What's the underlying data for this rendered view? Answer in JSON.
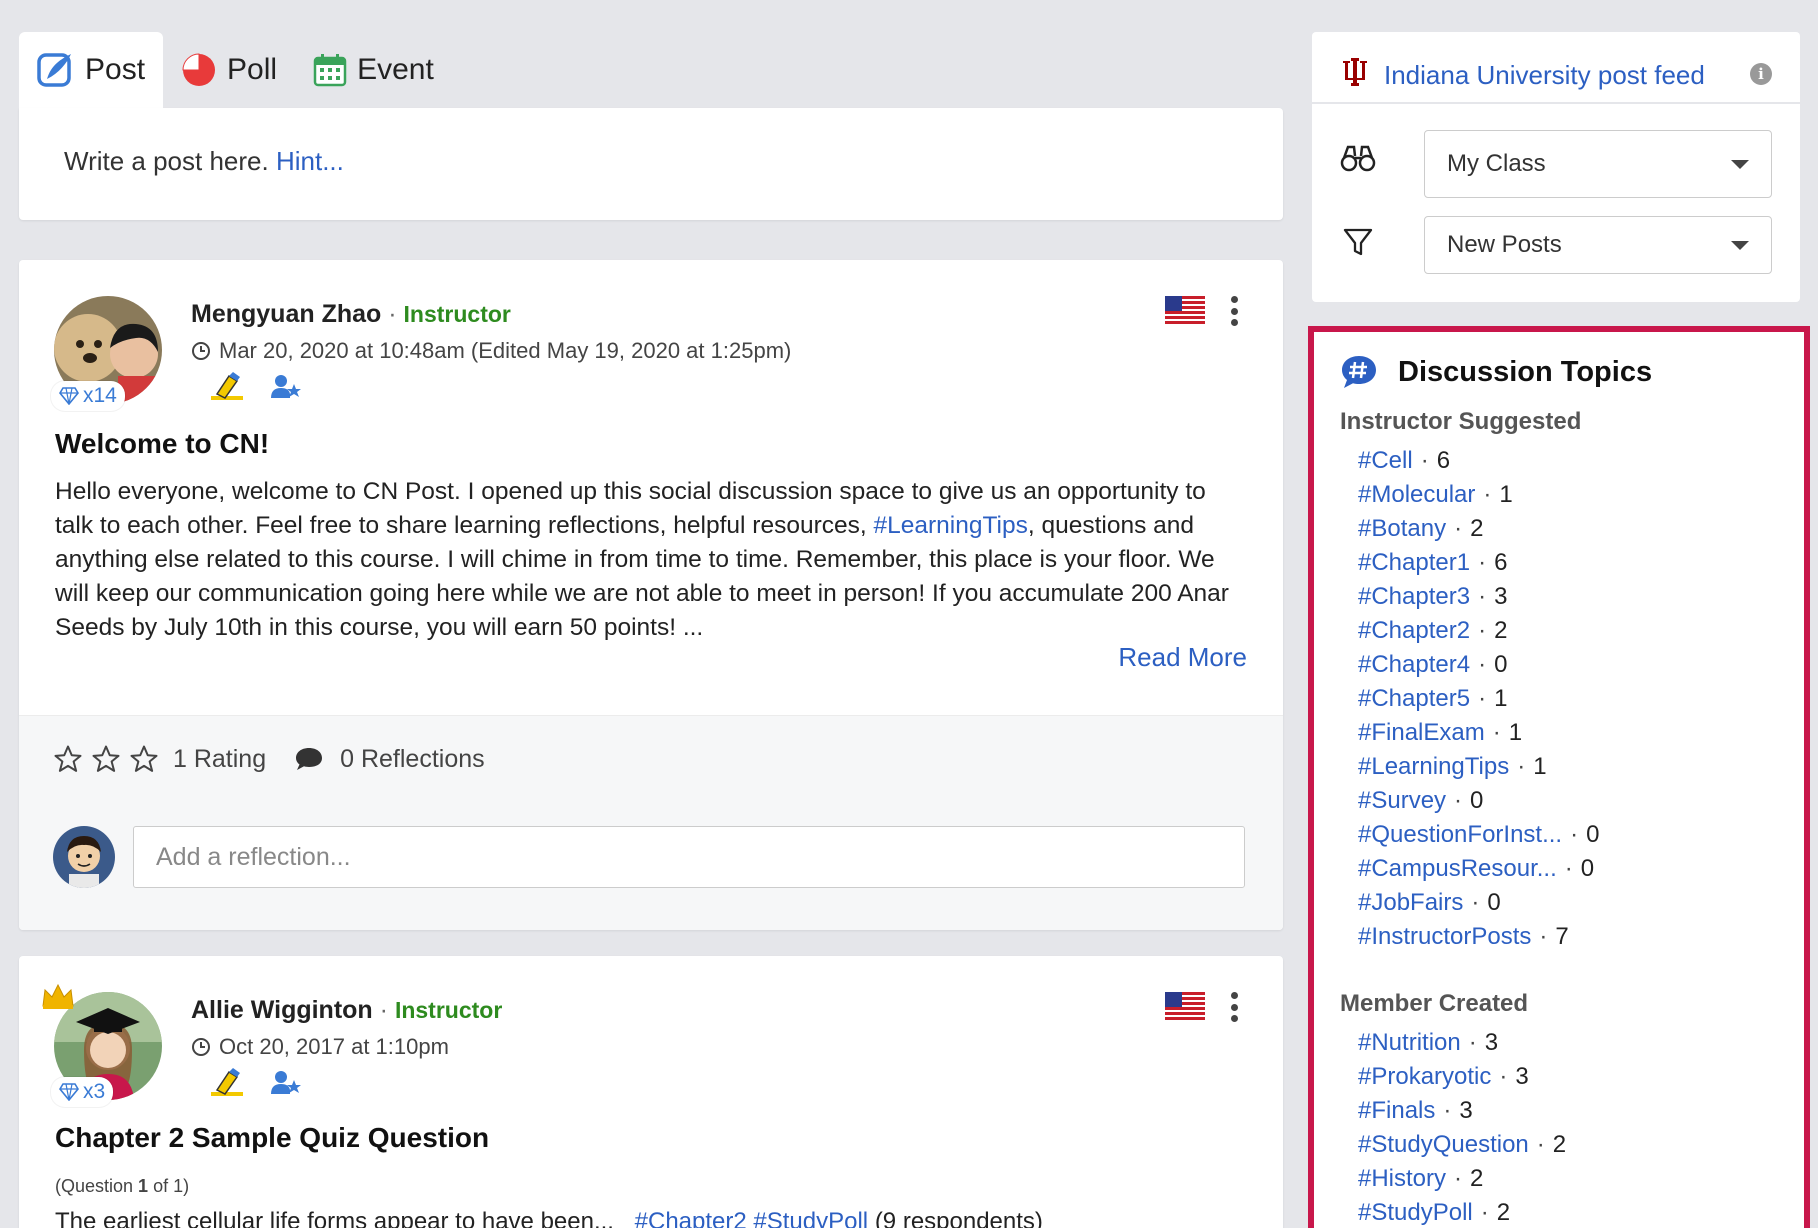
{
  "tabs": [
    {
      "label": "Post",
      "icon": "post-pen-icon",
      "active": true
    },
    {
      "label": "Poll",
      "icon": "pie-chart-icon",
      "active": false
    },
    {
      "label": "Event",
      "icon": "calendar-icon",
      "active": false
    }
  ],
  "composer": {
    "placeholder": "Write a post here.",
    "hint": "Hint..."
  },
  "post1": {
    "author": "Mengyuan Zhao",
    "role": "Instructor",
    "timestamp": "Mar 20, 2020 at 10:48am (Edited May 19, 2020 at 1:25pm)",
    "badge_count": "x14",
    "title": "Welcome to CN!",
    "body_before": "Hello everyone, welcome to CN Post. I opened up this social discussion space to give us an opportunity to talk to each other. Feel free to share learning reflections, helpful resources, ",
    "body_tag": "#LearningTips",
    "body_after": ", questions and anything else related to this course. I will chime in from time to time. Remember, this place is your floor. We will keep our communication going here while we are not able to meet in person! If you accumulate 200 Anar Seeds by July 10th in this course, you will earn 50 points! ...",
    "read_more": "Read More",
    "rating_label": "1 Rating",
    "reflections_label": "0 Reflections",
    "reflection_placeholder": "Add a reflection..."
  },
  "post2": {
    "author": "Allie Wigginton",
    "role": "Instructor",
    "timestamp": "Oct 20, 2017 at 1:10pm",
    "badge_count": "x3",
    "title": "Chapter 2 Sample Quiz Question",
    "question_meta_pre": "(Question ",
    "question_meta_num": "1",
    "question_meta_post": " of 1)",
    "question_text": "The earliest cellular life forms appear to have been...",
    "tags": [
      "#Chapter2",
      "#StudyPoll"
    ],
    "respondents": "(9 respondents)"
  },
  "feed": {
    "title": "Indiana University post feed",
    "info_glyph": "i"
  },
  "filters": {
    "audience": "My Class",
    "sort": "New Posts"
  },
  "topics": {
    "title": "Discussion Topics",
    "instructor_label": "Instructor Suggested",
    "instructor": [
      {
        "tag": "#Cell",
        "count": "6"
      },
      {
        "tag": "#Molecular",
        "count": "1"
      },
      {
        "tag": "#Botany",
        "count": "2"
      },
      {
        "tag": "#Chapter1",
        "count": "6"
      },
      {
        "tag": "#Chapter3",
        "count": "3"
      },
      {
        "tag": "#Chapter2",
        "count": "2"
      },
      {
        "tag": "#Chapter4",
        "count": "0"
      },
      {
        "tag": "#Chapter5",
        "count": "1"
      },
      {
        "tag": "#FinalExam",
        "count": "1"
      },
      {
        "tag": "#LearningTips",
        "count": "1"
      },
      {
        "tag": "#Survey",
        "count": "0"
      },
      {
        "tag": "#QuestionForInst...",
        "count": "0"
      },
      {
        "tag": "#CampusResour...",
        "count": "0"
      },
      {
        "tag": "#JobFairs",
        "count": "0"
      },
      {
        "tag": "#InstructorPosts",
        "count": "7"
      }
    ],
    "member_label": "Member Created",
    "member": [
      {
        "tag": "#Nutrition",
        "count": "3"
      },
      {
        "tag": "#Prokaryotic",
        "count": "3"
      },
      {
        "tag": "#Finals",
        "count": "3"
      },
      {
        "tag": "#StudyQuestion",
        "count": "2"
      },
      {
        "tag": "#History",
        "count": "2"
      },
      {
        "tag": "#StudyPoll",
        "count": "2"
      }
    ]
  },
  "colors": {
    "accent": "#2c5fc2",
    "instructor": "#2e8b1f",
    "highlight_border": "#c8174b",
    "iu_red": "#990000"
  }
}
